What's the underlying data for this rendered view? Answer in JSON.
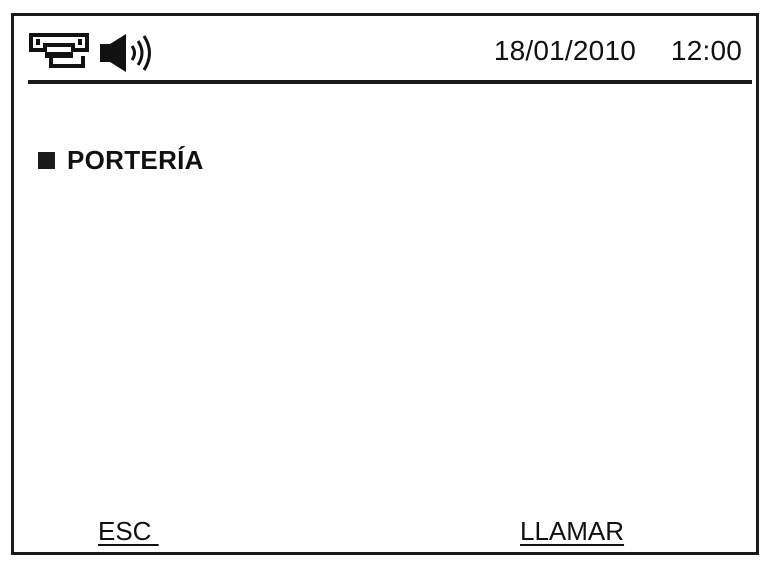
{
  "status_bar": {
    "intercom_icon": "intercom-handset-icon",
    "speaker_icon": "speaker-volume-icon",
    "date": "18/01/2010",
    "time": "12:00"
  },
  "menu": {
    "items": [
      {
        "label": "PORTERÍA",
        "selected": true
      }
    ]
  },
  "softkeys": {
    "left_label": "ESC ",
    "right_label": "LLAMAR"
  },
  "colors": {
    "foreground": "#111111",
    "background": "#ffffff",
    "border": "#1a1a1a"
  }
}
